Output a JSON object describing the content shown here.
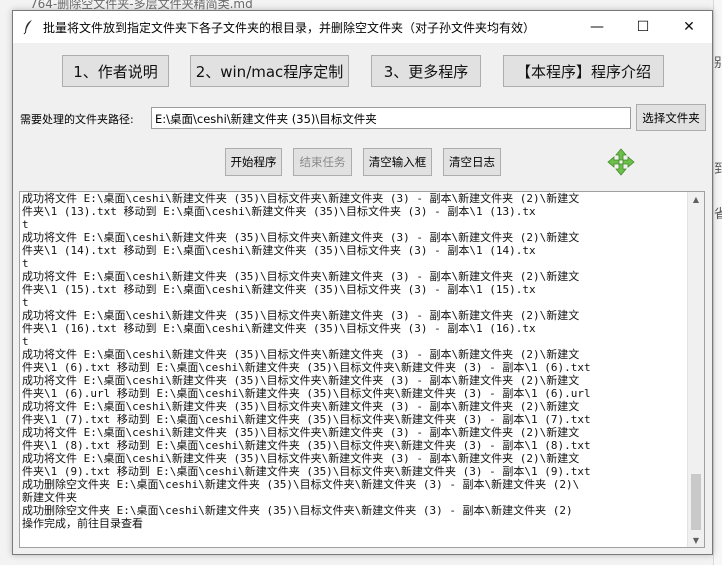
{
  "background": {
    "editor_tab": "764-删除空文件夹-多层文件夹精简类.md",
    "right_chars": [
      "别",
      "到",
      "省"
    ]
  },
  "window": {
    "title": "批量将文件放到指定文件夹下各子文件夹的根目录，并删除空文件夹（对子孙文件夹均有效）",
    "icon": "feather-icon",
    "controls": {
      "minimize": "—",
      "maximize": "☐",
      "close": "✕"
    }
  },
  "top_buttons": [
    "1、作者说明",
    "2、win/mac程序定制",
    "3、更多程序",
    "【本程序】程序介绍"
  ],
  "path": {
    "label": "需要处理的文件夹路径:",
    "value": "E:\\桌面\\ceshi\\新建文件夹 (35)\\目标文件夹",
    "choose_button": "选择文件夹"
  },
  "actions": {
    "start": "开始程序",
    "stop": "结束任务",
    "clear_input": "清空输入框",
    "clear_log": "清空日志",
    "move_icon": "move-arrows-icon"
  },
  "colors": {
    "move_icon": "#6cc04a"
  },
  "log": {
    "text": "成功将文件 E:\\桌面\\ceshi\\新建文件夹 (35)\\目标文件夹\\新建文件夹 (3) - 副本\\新建文件夹 (2)\\新建文\n件夹\\1 (13).txt 移动到 E:\\桌面\\ceshi\\新建文件夹 (35)\\目标文件夹 (3) - 副本\\1 (13).tx\nt\n成功将文件 E:\\桌面\\ceshi\\新建文件夹 (35)\\目标文件夹\\新建文件夹 (3) - 副本\\新建文件夹 (2)\\新建文\n件夹\\1 (14).txt 移动到 E:\\桌面\\ceshi\\新建文件夹 (35)\\目标文件夹 (3) - 副本\\1 (14).tx\nt\n成功将文件 E:\\桌面\\ceshi\\新建文件夹 (35)\\目标文件夹\\新建文件夹 (3) - 副本\\新建文件夹 (2)\\新建文\n件夹\\1 (15).txt 移动到 E:\\桌面\\ceshi\\新建文件夹 (35)\\目标文件夹 (3) - 副本\\1 (15).tx\nt\n成功将文件 E:\\桌面\\ceshi\\新建文件夹 (35)\\目标文件夹\\新建文件夹 (3) - 副本\\新建文件夹 (2)\\新建文\n件夹\\1 (16).txt 移动到 E:\\桌面\\ceshi\\新建文件夹 (35)\\目标文件夹 (3) - 副本\\1 (16).tx\nt\n成功将文件 E:\\桌面\\ceshi\\新建文件夹 (35)\\目标文件夹\\新建文件夹 (3) - 副本\\新建文件夹 (2)\\新建文\n件夹\\1 (6).txt 移动到 E:\\桌面\\ceshi\\新建文件夹 (35)\\目标文件夹\\新建文件夹 (3) - 副本\\1 (6).txt\n成功将文件 E:\\桌面\\ceshi\\新建文件夹 (35)\\目标文件夹\\新建文件夹 (3) - 副本\\新建文件夹 (2)\\新建文\n件夹\\1 (6).url 移动到 E:\\桌面\\ceshi\\新建文件夹 (35)\\目标文件夹\\新建文件夹 (3) - 副本\\1 (6).url\n成功将文件 E:\\桌面\\ceshi\\新建文件夹 (35)\\目标文件夹\\新建文件夹 (3) - 副本\\新建文件夹 (2)\\新建文\n件夹\\1 (7).txt 移动到 E:\\桌面\\ceshi\\新建文件夹 (35)\\目标文件夹\\新建文件夹 (3) - 副本\\1 (7).txt\n成功将文件 E:\\桌面\\ceshi\\新建文件夹 (35)\\目标文件夹\\新建文件夹 (3) - 副本\\新建文件夹 (2)\\新建文\n件夹\\1 (8).txt 移动到 E:\\桌面\\ceshi\\新建文件夹 (35)\\目标文件夹\\新建文件夹 (3) - 副本\\1 (8).txt\n成功将文件 E:\\桌面\\ceshi\\新建文件夹 (35)\\目标文件夹\\新建文件夹 (3) - 副本\\新建文件夹 (2)\\新建文\n件夹\\1 (9).txt 移动到 E:\\桌面\\ceshi\\新建文件夹 (35)\\目标文件夹\\新建文件夹 (3) - 副本\\1 (9).txt\n成功删除空文件夹 E:\\桌面\\ceshi\\新建文件夹 (35)\\目标文件夹\\新建文件夹 (3) - 副本\\新建文件夹 (2)\\\n新建文件夹\n成功删除空文件夹 E:\\桌面\\ceshi\\新建文件夹 (35)\\目标文件夹\\新建文件夹 (3) - 副本\\新建文件夹 (2)\n操作完成，前往目录查看"
  }
}
